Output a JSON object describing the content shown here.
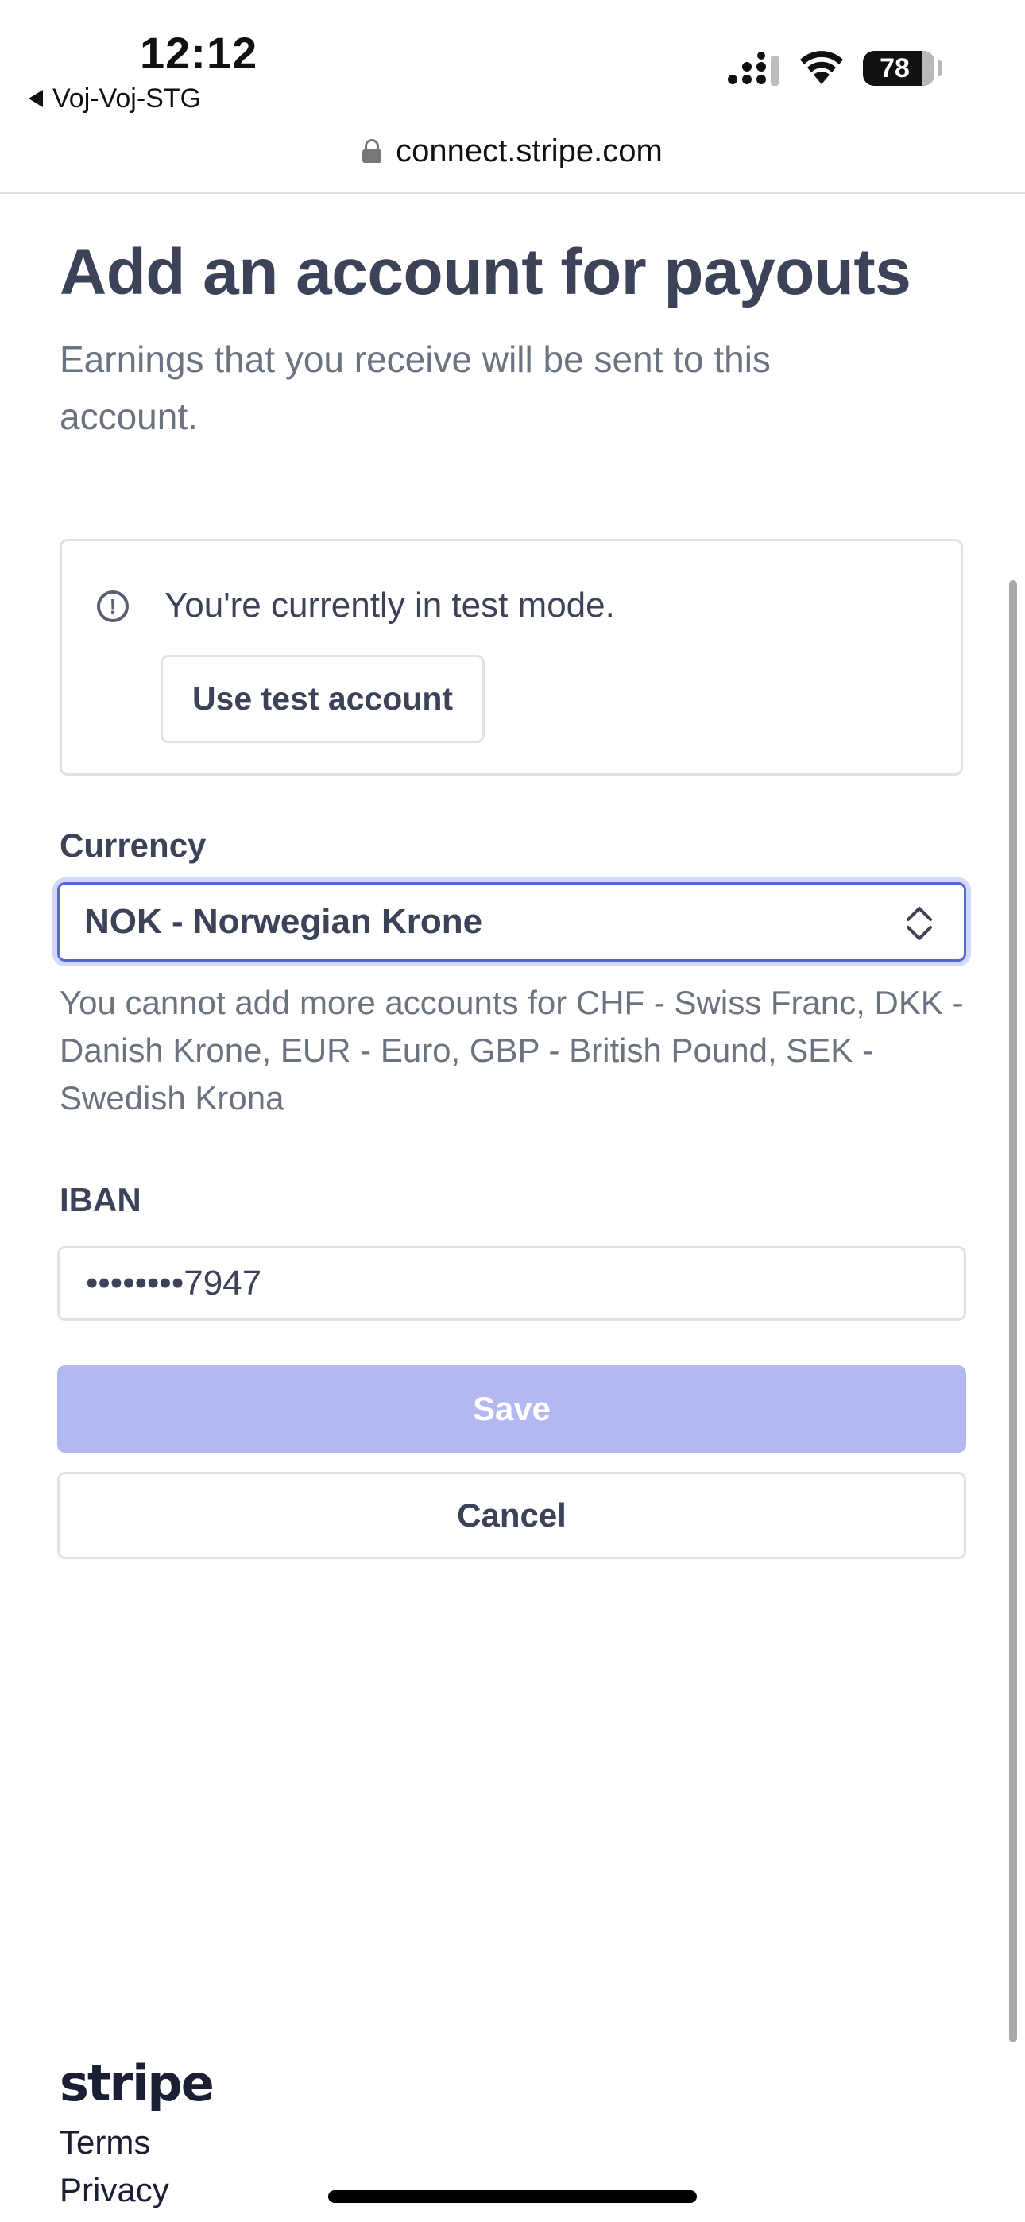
{
  "status_bar": {
    "time": "12:12",
    "back_app": "Voj-Voj-STG",
    "battery": "78"
  },
  "browser": {
    "url": "connect.stripe.com"
  },
  "header": {
    "title": "Add an account for payouts",
    "subtitle": "Earnings that you receive will be sent to this account."
  },
  "test_mode": {
    "message": "You're currently in test mode.",
    "button_label": "Use test account",
    "icon": "alert-circle-icon"
  },
  "currency": {
    "label": "Currency",
    "selected": "NOK - Norwegian Krone",
    "note": "You cannot add more accounts for CHF - Swiss Franc, DKK - Danish Krone, EUR - Euro, GBP - British Pound, SEK - Swedish Krona"
  },
  "iban": {
    "label": "IBAN",
    "value": "••••••••7947"
  },
  "actions": {
    "save_label": "Save",
    "cancel_label": "Cancel"
  },
  "footer": {
    "logo": "stripe",
    "terms": "Terms",
    "privacy": "Privacy"
  },
  "colors": {
    "accent": "#5469d4",
    "save_disabled": "#b3b7f2",
    "text": "#3c4257",
    "muted": "#6b7280"
  }
}
